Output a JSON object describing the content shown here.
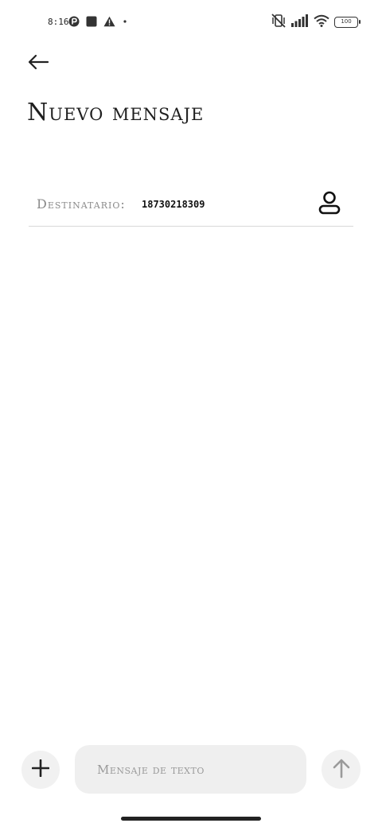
{
  "status_bar": {
    "time": "8:16",
    "battery": "100",
    "icons": [
      "notification-app-icon",
      "stop-square-icon",
      "warning-icon",
      "dot-icon",
      "vibrate-off-icon",
      "signal-icon",
      "wifi-icon",
      "battery-icon"
    ]
  },
  "header": {
    "back_icon": "arrow-left-icon",
    "title": "Nuevo mensaje"
  },
  "recipient": {
    "label": "Destinatario:",
    "value": "18730218309",
    "contact_icon": "person-icon"
  },
  "composer": {
    "add_icon": "plus-icon",
    "placeholder": "Mensaje de texto",
    "value": "",
    "send_icon": "arrow-up-icon"
  },
  "colors": {
    "background": "#ffffff",
    "text": "#1f1f1f",
    "muted": "#8a8a8a",
    "divider": "#d9d9d9",
    "button_bg": "#f1f1f1",
    "field_bg": "#efefef"
  }
}
